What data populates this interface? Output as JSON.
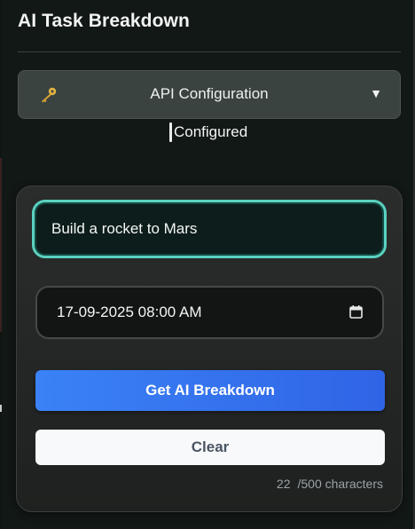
{
  "app": {
    "title": "AI Task Breakdown"
  },
  "api_config": {
    "label": "API Configuration",
    "caret": "▼",
    "status": "Configured",
    "icon": "key-icon"
  },
  "task_form": {
    "task_value": "Build a rocket to Mars",
    "datetime_value": "17-09-2025 08:00 AM",
    "primary_button": "Get AI Breakdown",
    "secondary_button": "Clear",
    "char_count_current": "22",
    "char_count_limit": "/500 characters"
  },
  "colors": {
    "accent_blue": "#3b82f6",
    "focus_ring": "#5bd1c0",
    "key_icon": "#e3b341"
  }
}
